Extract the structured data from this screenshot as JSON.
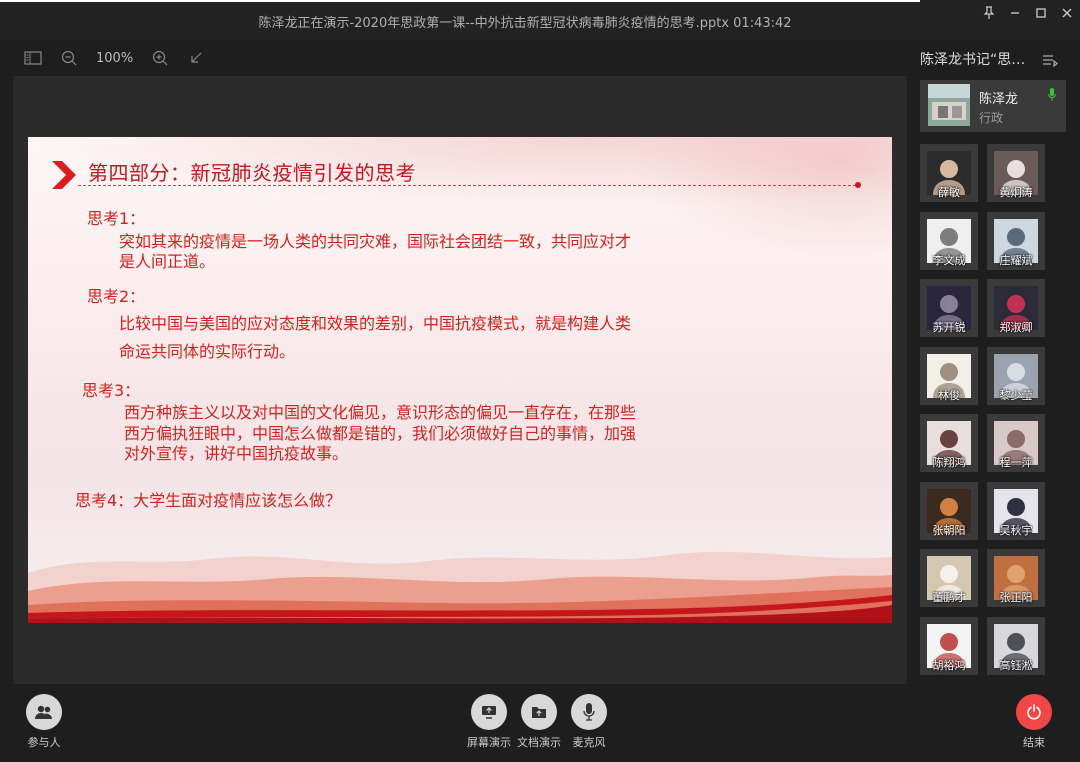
{
  "window": {
    "title": "陈泽龙正在演示-2020年思政第一课--中外抗击新型冠状病毒肺炎疫情的思考.pptx 01:43:42"
  },
  "toolbar": {
    "zoom": "100%"
  },
  "slide": {
    "title": "第四部分：新冠肺炎疫情引发的思考",
    "q1_head": "思考1：",
    "q1_line1": "突如其来的疫情是一场人类的共同灾难，国际社会团结一致，共同应对才",
    "q1_line2": "是人间正道。",
    "q2_head": "思考2：",
    "q2_line1": "比较中国与美国的应对态度和效果的差别，中国抗疫模式，就是构建人类",
    "q2_line2": "命运共同体的实际行动。",
    "q3_head": "思考3：",
    "q3_line1": "西方种族主义以及对中国的文化偏见，意识形态的偏见一直存在，在那些",
    "q3_line2": "西方偏执狂眼中，中国怎么做都是错的，我们必须做好自己的事情，加强",
    "q3_line3": "对外宣传，讲好中国抗疫故事。",
    "q4": "思考4：大学生面对疫情应该怎么做？"
  },
  "side": {
    "title": "陈泽龙书记“思…",
    "presenter_name": "陈泽龙",
    "presenter_role": "行政",
    "participants": [
      "薛敏",
      "黄炯涛",
      "李文成",
      "庄耀斌",
      "苏开锐",
      "郑淑卿",
      "林俊",
      "黎少莹",
      "陈翔鸿",
      "程一萍",
      "张朝阳",
      "吴秋宇",
      "董鹏才",
      "张正阳",
      "胡裕鸿",
      "高钰淞"
    ]
  },
  "bottom": {
    "participants_label": "参与人",
    "screen_share_label": "屏幕演示",
    "doc_share_label": "文档演示",
    "mic_label": "麦克风",
    "end_label": "结束"
  },
  "colors": {
    "accent_red": "#c4161c",
    "end_button": "#f04848",
    "mic_active": "#3cc13c"
  }
}
